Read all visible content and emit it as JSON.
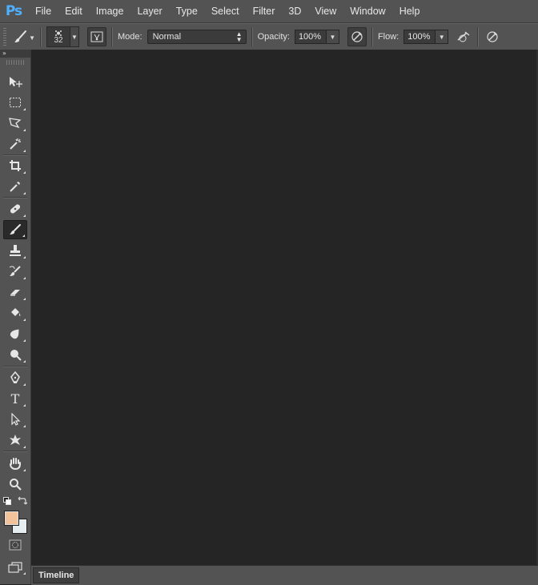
{
  "app": {
    "logo_text": "Ps"
  },
  "menu": [
    "File",
    "Edit",
    "Image",
    "Layer",
    "Type",
    "Select",
    "Filter",
    "3D",
    "View",
    "Window",
    "Help"
  ],
  "options": {
    "brush_size": "32",
    "mode_label": "Mode:",
    "mode_value": "Normal",
    "opacity_label": "Opacity:",
    "opacity_value": "100%",
    "flow_label": "Flow:",
    "flow_value": "100%"
  },
  "toolbox": {
    "collapse_glyph": "»",
    "tools": [
      {
        "name": "move-tool",
        "icon": "move-icon"
      },
      {
        "name": "rectangular-marquee-tool",
        "icon": "marquee-icon"
      },
      {
        "name": "lasso-tool",
        "icon": "lasso-icon"
      },
      {
        "name": "magic-wand-tool",
        "icon": "magic-wand-icon"
      },
      {
        "name": "crop-tool",
        "icon": "crop-icon"
      },
      {
        "name": "eyedropper-tool",
        "icon": "eyedropper-icon"
      },
      {
        "name": "healing-brush-tool",
        "icon": "bandage-icon"
      },
      {
        "name": "brush-tool",
        "icon": "brush-icon"
      },
      {
        "name": "clone-stamp-tool",
        "icon": "stamp-icon"
      },
      {
        "name": "history-brush-tool",
        "icon": "history-brush-icon"
      },
      {
        "name": "eraser-tool",
        "icon": "eraser-icon"
      },
      {
        "name": "paint-bucket-tool",
        "icon": "bucket-icon"
      },
      {
        "name": "blur-tool",
        "icon": "blur-icon"
      },
      {
        "name": "dodge-tool",
        "icon": "dodge-icon"
      },
      {
        "name": "pen-tool",
        "icon": "pen-icon"
      },
      {
        "name": "type-tool",
        "icon": "type-icon"
      },
      {
        "name": "path-selection-tool",
        "icon": "arrow-icon"
      },
      {
        "name": "custom-shape-tool",
        "icon": "shape-icon"
      },
      {
        "name": "hand-tool",
        "icon": "hand-icon"
      },
      {
        "name": "zoom-tool",
        "icon": "zoom-icon"
      }
    ],
    "type_glyph": "T",
    "foreground_color": "#f2c39a",
    "background_color": "#e6eef2"
  },
  "timeline": {
    "tab_label": "Timeline"
  }
}
